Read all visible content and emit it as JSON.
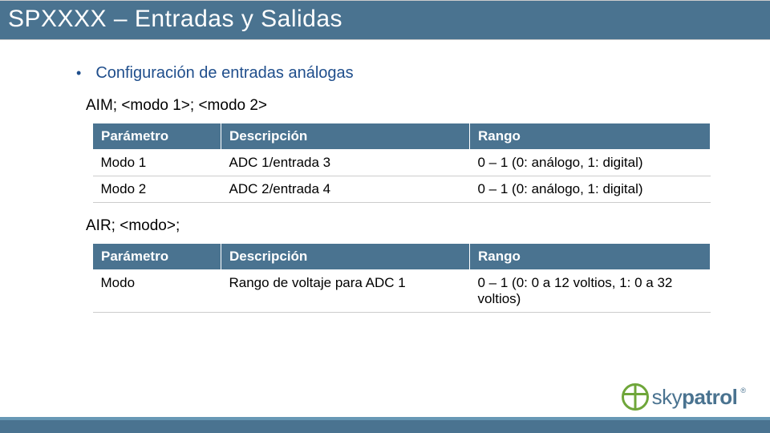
{
  "title": "SPXXXX – Entradas y Salidas",
  "bullet": "Configuración de entradas análogas",
  "cmd1": "AIM; <modo 1>; <modo 2>",
  "cmd2": "AIR; <modo>;",
  "table1": {
    "headers": {
      "h1": "Parámetro",
      "h2": "Descripción",
      "h3": "Rango"
    },
    "rows": [
      {
        "p": "Modo 1",
        "d": "ADC 1/entrada 3",
        "r": "0 – 1 (0: análogo, 1: digital)"
      },
      {
        "p": "Modo 2",
        "d": "ADC 2/entrada 4",
        "r": "0 – 1 (0: análogo, 1: digital)"
      }
    ]
  },
  "table2": {
    "headers": {
      "h1": "Parámetro",
      "h2": "Descripción",
      "h3": "Rango"
    },
    "rows": [
      {
        "p": "Modo",
        "d": "Rango de voltaje para ADC 1",
        "r": "0 – 1 (0: 0 a 12 voltios, 1: 0 a 32 voltios)"
      }
    ]
  },
  "logo": {
    "text1": "sky",
    "text2": "patrol"
  }
}
